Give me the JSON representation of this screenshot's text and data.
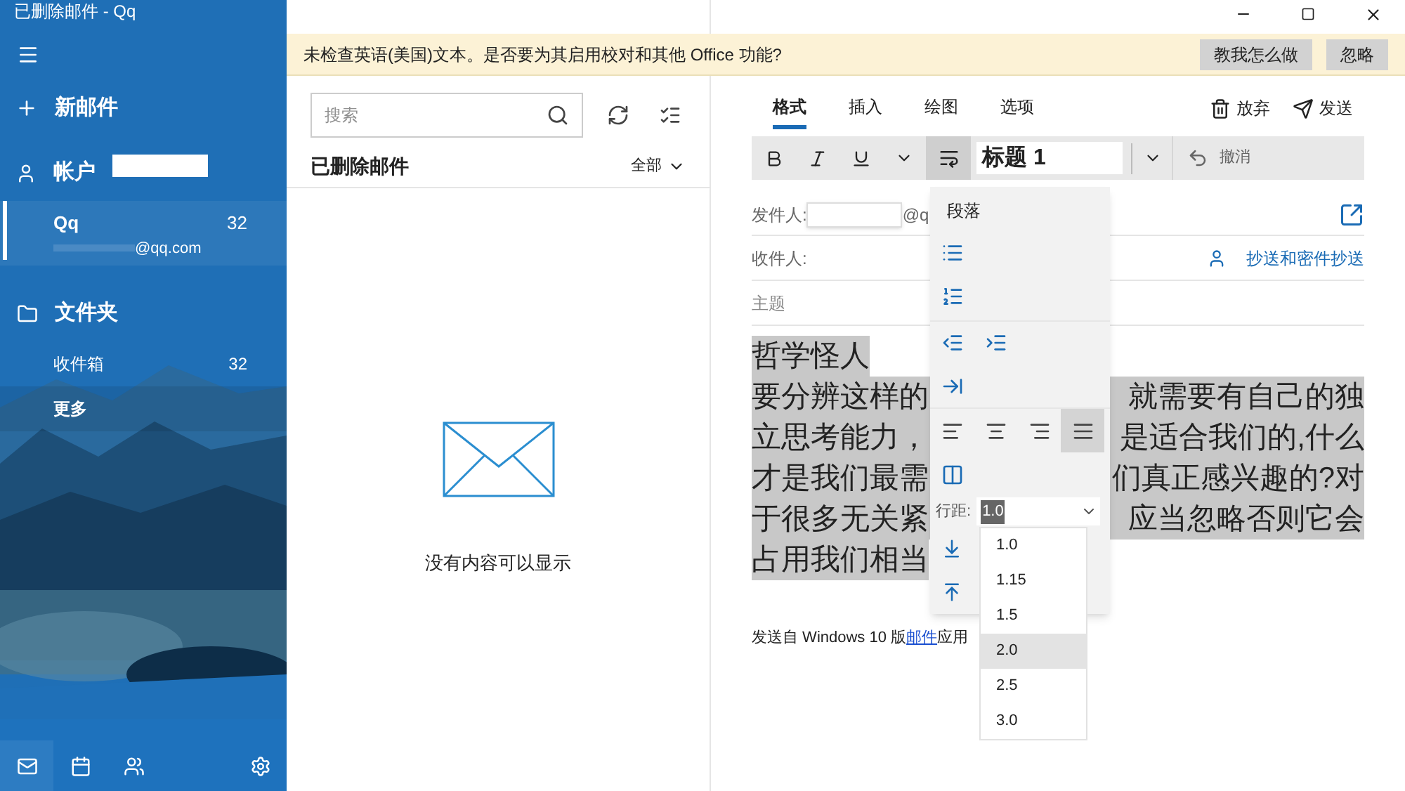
{
  "window": {
    "title": "已删除邮件 - Qq"
  },
  "sidebar": {
    "new_mail": "新邮件",
    "accounts_heading": "帐户",
    "account": {
      "name": "Qq",
      "count": "32",
      "email": "@qq.com",
      "selected": true
    },
    "folders_heading": "文件夹",
    "folders": [
      {
        "name": "收件箱",
        "count": "32"
      },
      {
        "name": "更多"
      }
    ],
    "nav": [
      {
        "kind": "mail",
        "selected": true
      },
      {
        "kind": "calendar",
        "selected": false
      },
      {
        "kind": "people",
        "selected": false
      },
      {
        "kind": "settings",
        "selected": false
      }
    ]
  },
  "notification": {
    "message": "未检查英语(美国)文本。是否要为其启用校对和其他 Office 功能?",
    "buttons": [
      "教我怎么做",
      "忽略"
    ]
  },
  "message_list": {
    "search": {
      "placeholder": "搜索"
    },
    "folder_title": "已删除邮件",
    "filter": "全部",
    "empty_text": "没有内容可以显示"
  },
  "compose": {
    "tabs": [
      {
        "label": "格式",
        "selected": true
      },
      {
        "label": "插入",
        "selected": false
      },
      {
        "label": "绘图",
        "selected": false
      },
      {
        "label": "选项",
        "selected": false
      }
    ],
    "actions": [
      "放弃",
      "发送"
    ],
    "toolbar": {
      "paragraph_open": true,
      "style": "标题 1",
      "undo": "撤消"
    },
    "from_label": "发件人:",
    "from_suffix": "@q",
    "to_label": "收件人:",
    "cc_link": "抄送和密件抄送",
    "subject_placeholder": "主题",
    "body": [
      {
        "left": "哲学怪人"
      },
      {
        "left": "要分辨这样的",
        "right": "就需要有自己的独"
      },
      {
        "left": "立思考能力，",
        "right": "是适合我们的,什么"
      },
      {
        "left": "才是我们最需",
        "right": "们真正感兴趣的?对"
      },
      {
        "left": "于很多无关紧",
        "right": "应当忽略否则它会"
      },
      {
        "left": "占用我们相当"
      }
    ],
    "signature": {
      "before": "发送自 Windows 10 版",
      "link": "邮件",
      "after": "应用"
    }
  },
  "paragraph_flyout": {
    "title": "段落",
    "alignments": [
      {
        "kind": "left",
        "selected": false
      },
      {
        "kind": "center",
        "selected": false
      },
      {
        "kind": "right",
        "selected": false
      },
      {
        "kind": "justify",
        "selected": true
      }
    ],
    "line_spacing_label": "行距:",
    "line_spacing_value": "1.0",
    "options": [
      {
        "label": "1.0",
        "selected": false
      },
      {
        "label": "1.15",
        "selected": false
      },
      {
        "label": "1.5",
        "selected": false
      },
      {
        "label": "2.0",
        "selected": true
      },
      {
        "label": "2.5",
        "selected": false
      },
      {
        "label": "3.0",
        "selected": false
      }
    ]
  }
}
